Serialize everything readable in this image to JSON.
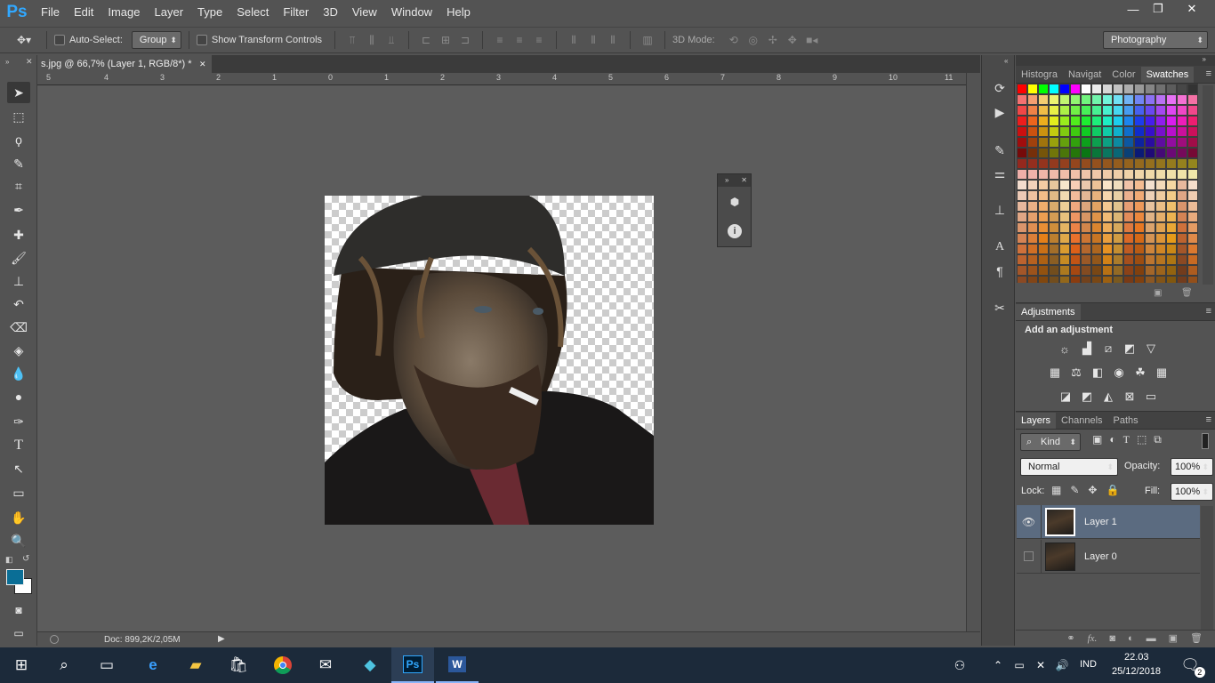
{
  "app": {
    "logo": "Ps"
  },
  "menu": [
    "File",
    "Edit",
    "Image",
    "Layer",
    "Type",
    "Select",
    "Filter",
    "3D",
    "View",
    "Window",
    "Help"
  ],
  "window_controls": {
    "minimize": "—",
    "restore": "❐",
    "close": "✕"
  },
  "options_bar": {
    "auto_select_label": "Auto-Select:",
    "auto_select_checked": false,
    "auto_select_value": "Group",
    "show_transform_label": "Show Transform Controls",
    "show_transform_checked": false,
    "mode_3d_label": "3D Mode:",
    "workspace": "Photography"
  },
  "document": {
    "tab_title": "s.jpg @ 66,7% (Layer 1, RGB/8*) *",
    "ruler_labels": [
      "5",
      "4",
      "3",
      "2",
      "1",
      "0",
      "1",
      "2",
      "3",
      "4",
      "5",
      "6",
      "7",
      "8",
      "9",
      "10",
      "11"
    ],
    "status": "Doc: 899,2K/2,05M"
  },
  "panels": {
    "top_tabs": [
      "Histogra",
      "Navigat",
      "Color",
      "Swatches"
    ],
    "active_top_tab": "Swatches",
    "adjustments_title": "Adjustments",
    "adjustments_subtitle": "Add an adjustment",
    "layers_tabs": [
      "Layers",
      "Channels",
      "Paths"
    ],
    "filter_kind": "Kind",
    "blend_mode": "Normal",
    "opacity_label": "Opacity:",
    "opacity_value": "100%",
    "lock_label": "Lock:",
    "fill_label": "Fill:",
    "fill_value": "100%",
    "layers": [
      {
        "name": "Layer 1",
        "visible": true,
        "selected": true
      },
      {
        "name": "Layer 0",
        "visible": false,
        "selected": false
      }
    ]
  },
  "colors": {
    "foreground": "#0a6e96",
    "background": "#ffffff",
    "selected_layer_bg": "#5b6b80"
  },
  "taskbar": {
    "language": "IND",
    "time": "22.03",
    "date": "25/12/2018",
    "notification_count": "2"
  }
}
